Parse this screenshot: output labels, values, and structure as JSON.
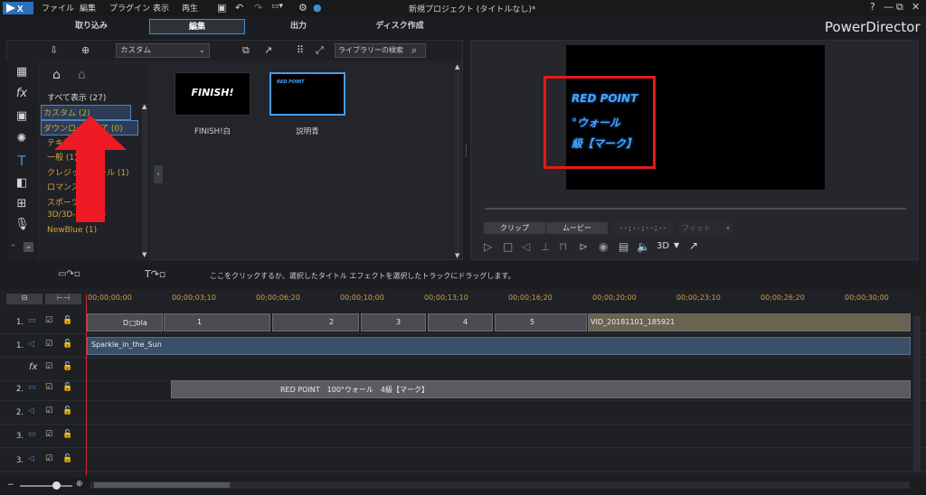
{
  "menu": [
    "ファイル",
    "編集",
    "プラグイン",
    "表示",
    "再生"
  ],
  "window": {
    "title": "新規プロジェクト (タイトルなし)*",
    "help": "?",
    "minimize": "—",
    "restore": "⧉",
    "close": "✕"
  },
  "modes": [
    "取り込み",
    "編集",
    "出力",
    "ディスク作成"
  ],
  "product": "PowerDirector",
  "library": {
    "dropdown": "カスタム",
    "search_placeholder": "ライブラリーの検索",
    "all": "すべて表示 (27)",
    "categories": [
      "カスタム (2)",
      "ダウンロード完了 (0)",
      "テキスト (1)",
      "一般 (1)",
      "クレジット/ロール (1)",
      "ロマンス (1)",
      "スポーツ (1)",
      "3D/3D-Like (1)",
      "NewBlue (1)"
    ],
    "items": [
      {
        "label": "FINISH!白",
        "thumb_text": "FINISH!"
      },
      {
        "label": "説明青",
        "thumb_text": "RED POINT"
      }
    ]
  },
  "preview": {
    "lines": [
      "RED POINT",
      "°ウォール",
      "級【マーク】"
    ],
    "clip_tab": "クリップ",
    "movie_tab": "ムービー",
    "timecode": "--;--;--;--",
    "fit": "フィット",
    "mode_3d": "3D"
  },
  "hint": "ここをクリックするか、選択したタイトル エフェクトを選択したトラックにドラッグします。",
  "ruler": [
    "00;00;00;00",
    "00;00;03;10",
    "00;00;06;20",
    "00;00;10;00",
    "00;00;13;10",
    "00;00;16;20",
    "00;00;20;00",
    "00;00;23;10",
    "00;00;26;20",
    "00;00;30;00"
  ],
  "tracks": [
    {
      "name": "1."
    },
    {
      "name": "1."
    },
    {
      "name": "fx"
    },
    {
      "name": "2."
    },
    {
      "name": "2."
    },
    {
      "name": "3."
    },
    {
      "name": "3."
    }
  ],
  "clips": {
    "video1_label": "Ｄ□bla",
    "numbers": [
      "1",
      "2",
      "3",
      "4",
      "5"
    ],
    "vid_name": "VID_20181101_185921",
    "audio": "Sparkle_in_the_Sun",
    "title_clip": "RED POINT　100°ウォール　4級【マーク】"
  },
  "colors": {
    "accent": "#3d8fd8",
    "timecode": "#c8a04a",
    "red_highlight": "#e31b1b",
    "category": "#d4a43a",
    "title_text": "#47a6ff"
  }
}
